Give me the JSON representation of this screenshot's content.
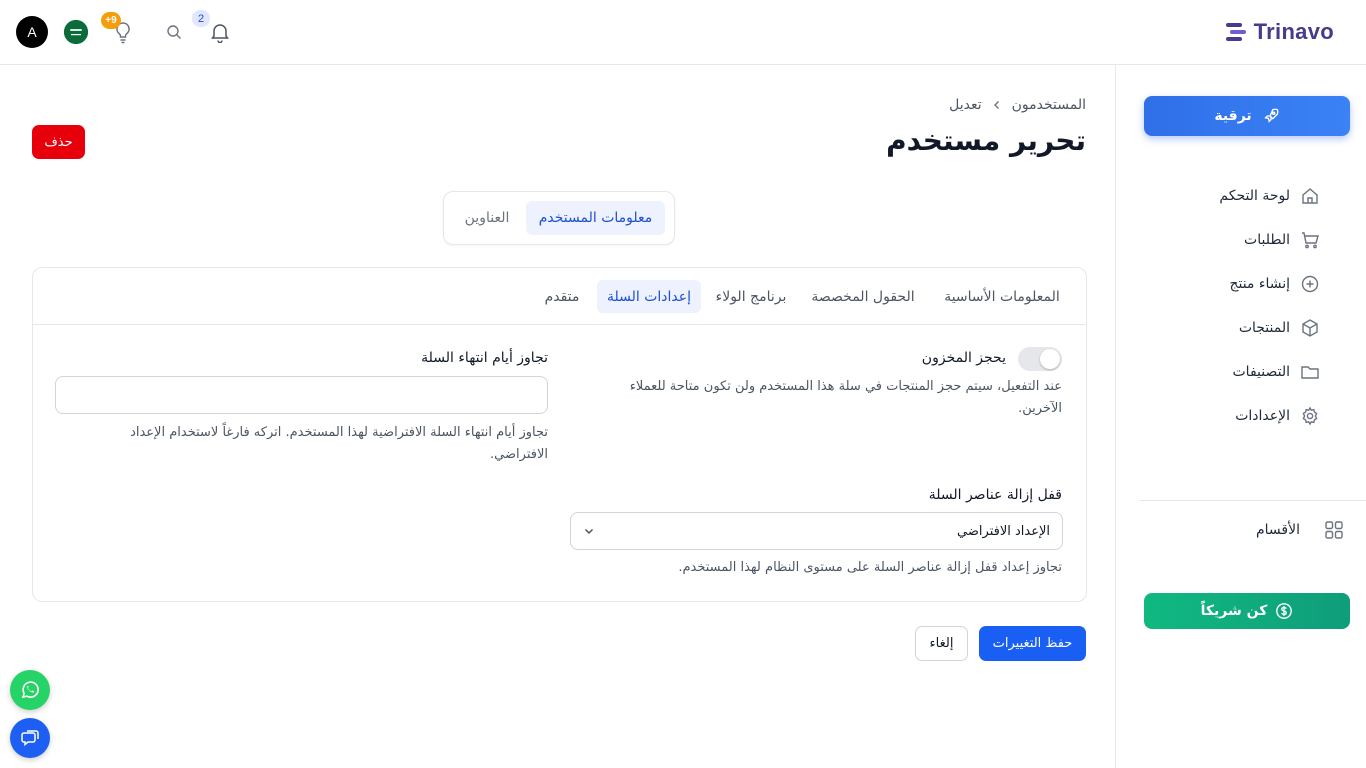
{
  "topbar": {
    "avatar_letter": "A",
    "bulb_badge": "+9",
    "bell_badge": "2",
    "logo_text": "Trinavo"
  },
  "sidebar": {
    "upgrade_label": "ترقية",
    "items": [
      {
        "label": "لوحة التحكم",
        "icon": "home-icon"
      },
      {
        "label": "الطلبات",
        "icon": "cart-icon"
      },
      {
        "label": "إنشاء منتج",
        "icon": "plus-circle-icon"
      },
      {
        "label": "المنتجات",
        "icon": "box-icon"
      },
      {
        "label": "التصنيفات",
        "icon": "folder-icon"
      },
      {
        "label": "الإعدادات",
        "icon": "gear-icon"
      }
    ],
    "sections_label": "الأقسام",
    "partner_label": "كن شريكاً"
  },
  "breadcrumb": {
    "parent": "المستخدمون",
    "current": "تعديل"
  },
  "page_title": "تحرير مستخدم",
  "delete_label": "حذف",
  "main_tabs": [
    {
      "label": "معلومات المستخدم",
      "active": true
    },
    {
      "label": "العناوين",
      "active": false
    }
  ],
  "sub_tabs": [
    {
      "label": "المعلومات الأساسية",
      "active": false
    },
    {
      "label": "الحقول المخصصة",
      "active": false
    },
    {
      "label": "برنامج الولاء",
      "active": false
    },
    {
      "label": "إعدادات السلة",
      "active": true
    },
    {
      "label": "متقدم",
      "active": false
    }
  ],
  "form": {
    "reserve_stock": {
      "label": "يحجز المخزون",
      "enabled": false,
      "help_line1": "عند التفعيل، سيتم حجز المنتجات في سلة هذا المستخدم ولن تكون متاحة للعملاء",
      "help_line2": "الآخرين."
    },
    "cart_expiry": {
      "label": "تجاوز أيام انتهاء السلة",
      "value": "",
      "help_line1": "تجاوز أيام انتهاء السلة الافتراضية لهذا المستخدم. اتركه فارغاً لاستخدام الإعداد",
      "help_line2": "الافتراضي."
    },
    "cart_lock": {
      "label": "قفل إزالة عناصر السلة",
      "selected": "الإعداد الافتراضي",
      "help": "تجاوز إعداد قفل إزالة عناصر السلة على مستوى النظام لهذا المستخدم."
    }
  },
  "actions": {
    "save_label": "حفظ التغييرات",
    "cancel_label": "إلغاء"
  },
  "colors": {
    "primary": "#1a5ff3",
    "danger": "#e7000b",
    "success": "#10b981",
    "brand": "#4a3a8c"
  }
}
